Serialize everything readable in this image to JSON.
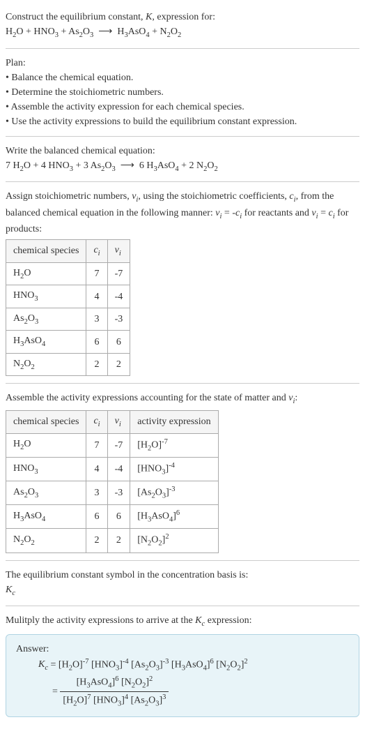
{
  "intro": {
    "line1": "Construct the equilibrium constant, K, expression for:",
    "equation": "H₂O + HNO₃ + As₂O₃ ⟶ H₃AsO₄ + N₂O₂"
  },
  "plan": {
    "title": "Plan:",
    "items": [
      "• Balance the chemical equation.",
      "• Determine the stoichiometric numbers.",
      "• Assemble the activity expression for each chemical species.",
      "• Use the activity expressions to build the equilibrium constant expression."
    ]
  },
  "balanced": {
    "title": "Write the balanced chemical equation:",
    "equation": "7 H₂O + 4 HNO₃ + 3 As₂O₃ ⟶ 6 H₃AsO₄ + 2 N₂O₂"
  },
  "stoich": {
    "intro_a": "Assign stoichiometric numbers, νᵢ, using the stoichiometric coefficients, cᵢ, from the balanced chemical equation in the following manner: νᵢ = -cᵢ for reactants and νᵢ = cᵢ for products:",
    "headers": [
      "chemical species",
      "cᵢ",
      "νᵢ"
    ],
    "rows": [
      {
        "species": "H₂O",
        "c": "7",
        "v": "-7"
      },
      {
        "species": "HNO₃",
        "c": "4",
        "v": "-4"
      },
      {
        "species": "As₂O₃",
        "c": "3",
        "v": "-3"
      },
      {
        "species": "H₃AsO₄",
        "c": "6",
        "v": "6"
      },
      {
        "species": "N₂O₂",
        "c": "2",
        "v": "2"
      }
    ]
  },
  "activity": {
    "intro": "Assemble the activity expressions accounting for the state of matter and νᵢ:",
    "headers": [
      "chemical species",
      "cᵢ",
      "νᵢ",
      "activity expression"
    ],
    "rows": [
      {
        "species": "H₂O",
        "c": "7",
        "v": "-7",
        "expr": "[H₂O]⁻⁷"
      },
      {
        "species": "HNO₃",
        "c": "4",
        "v": "-4",
        "expr": "[HNO₃]⁻⁴"
      },
      {
        "species": "As₂O₃",
        "c": "3",
        "v": "-3",
        "expr": "[As₂O₃]⁻³"
      },
      {
        "species": "H₃AsO₄",
        "c": "6",
        "v": "6",
        "expr": "[H₃AsO₄]⁶"
      },
      {
        "species": "N₂O₂",
        "c": "2",
        "v": "2",
        "expr": "[N₂O₂]²"
      }
    ]
  },
  "symbol": {
    "line1": "The equilibrium constant symbol in the concentration basis is:",
    "line2": "K_c"
  },
  "multiply": {
    "line": "Mulitply the activity expressions to arrive at the K_c expression:"
  },
  "answer": {
    "label": "Answer:",
    "line1_left": "K_c = ",
    "line1_right": "[H₂O]⁻⁷ [HNO₃]⁻⁴ [As₂O₃]⁻³ [H₃AsO₄]⁶ [N₂O₂]²",
    "eq_prefix": "= ",
    "frac_num": "[H₃AsO₄]⁶ [N₂O₂]²",
    "frac_den": "[H₂O]⁷ [HNO₃]⁴ [As₂O₃]³"
  }
}
